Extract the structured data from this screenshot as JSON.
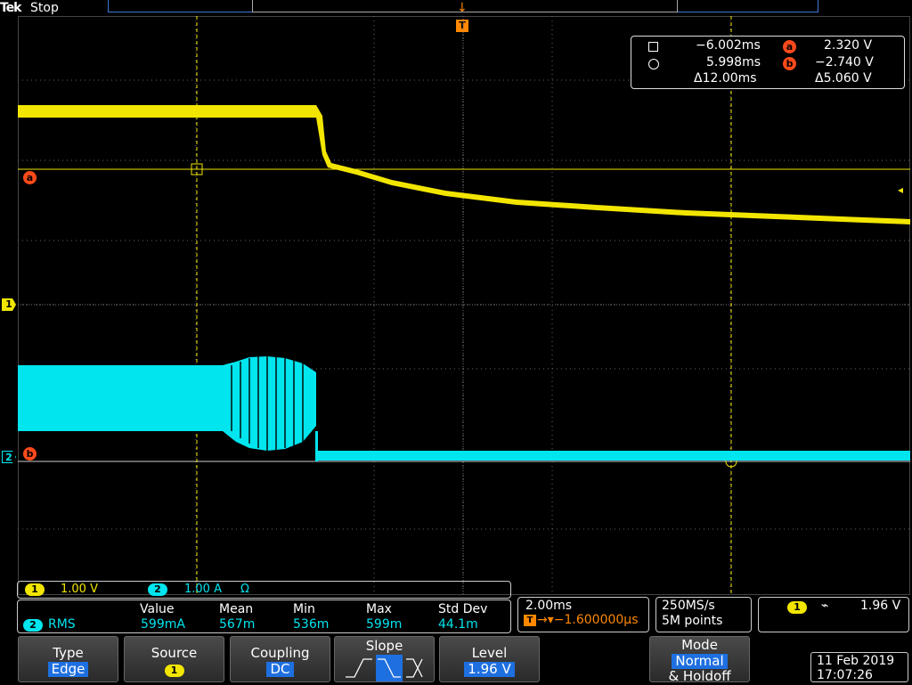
{
  "header": {
    "brand": "Tek",
    "status": "Stop"
  },
  "markers": {
    "channel1": "1",
    "channel2": "2",
    "cursor_a": "a",
    "cursor_b": "b",
    "trigger": "T",
    "trigger_arrow": "↓",
    "trigger_level": "◂"
  },
  "cursors": {
    "row1": {
      "time": "−6.002ms",
      "value": "2.320 V"
    },
    "row2": {
      "time": "5.998ms",
      "value": "−2.740 V"
    },
    "row3": {
      "delta_time": "Δ12.00ms",
      "delta_value": "Δ5.060 V"
    }
  },
  "channels": {
    "ch1": {
      "badge": "1",
      "scale": "1.00 V"
    },
    "ch2": {
      "badge": "2",
      "scale": "1.00 A",
      "unit_symbol": "Ω"
    }
  },
  "measurement": {
    "source_badge": "2",
    "name": "RMS",
    "headers": {
      "value": "Value",
      "mean": "Mean",
      "min": "Min",
      "max": "Max",
      "std": "Std Dev"
    },
    "values": {
      "value": "599mA",
      "mean": "567m",
      "min": "536m",
      "max": "599m",
      "std": "44.1m"
    }
  },
  "horizontal": {
    "scale": "2.00ms",
    "trigger_position": "→▾−1.600000µs"
  },
  "acquisition": {
    "sample_rate": "250MS/s",
    "record_length": "5M points"
  },
  "trigger": {
    "source_badge": "1",
    "slope_symbol": "⌁",
    "level": "1.96 V"
  },
  "menu": {
    "type": {
      "label": "Type",
      "value": "Edge"
    },
    "source": {
      "label": "Source",
      "value": "1"
    },
    "coupling": {
      "label": "Coupling",
      "value": "DC"
    },
    "slope": {
      "label": "Slope"
    },
    "level": {
      "label": "Level",
      "value": "1.96 V"
    },
    "mode": {
      "label": "Mode",
      "value": "Normal",
      "label2": "& Holdoff"
    }
  },
  "datetime": {
    "date": "11 Feb 2019",
    "time": "17:07:26"
  },
  "colors": {
    "ch1": "#f2e600",
    "ch2": "#00e5ee",
    "cursor": "#ff4a1a",
    "trigger": "#ff8800",
    "menu_value": "#1e6fe0"
  }
}
